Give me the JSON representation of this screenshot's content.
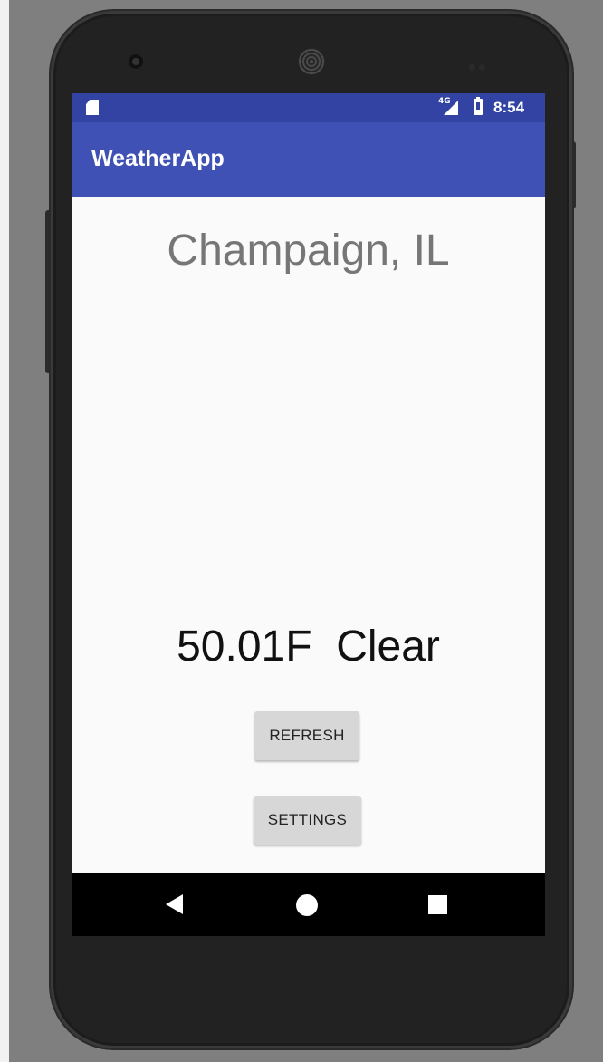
{
  "status_bar": {
    "network_label": "4G",
    "time": "8:54",
    "left_icon": "sd-card-icon",
    "signal_icon": "cell-signal-icon",
    "battery_icon": "battery-icon",
    "color": "#3343a3"
  },
  "app_bar": {
    "title": "WeatherApp",
    "color": "#3f51b5"
  },
  "main": {
    "city": "Champaign, IL",
    "weather": "50.01F  Clear",
    "refresh_label": "REFRESH",
    "settings_label": "SETTINGS"
  },
  "nav_bar": {
    "back_icon": "back-icon",
    "home_icon": "home-icon",
    "recent_icon": "recent-apps-icon"
  }
}
